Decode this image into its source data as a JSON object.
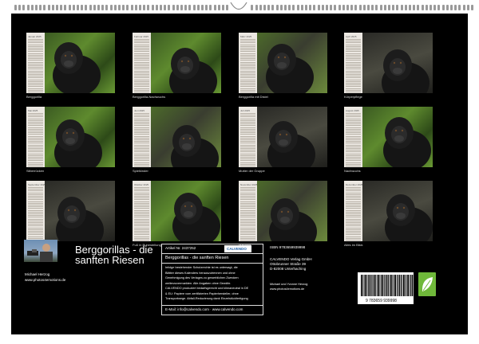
{
  "months": [
    {
      "name": "Januar 2025",
      "caption": "Berggorilla",
      "bg": "bg-green"
    },
    {
      "name": "Februar 2025",
      "caption": "Berggorilla-Nachwuchs",
      "bg": "bg-green"
    },
    {
      "name": "März 2025",
      "caption": "Berggorilla mit Distel",
      "bg": "bg-mid"
    },
    {
      "name": "April 2025",
      "caption": "Körperpflege",
      "bg": "bg-dark"
    },
    {
      "name": "Mai 2025",
      "caption": "Silberrücken",
      "bg": "bg-green"
    },
    {
      "name": "Juni 2025",
      "caption": "Spielkinder",
      "bg": "bg-mid"
    },
    {
      "name": "Juli 2025",
      "caption": "Mutter der Gruppe",
      "bg": "bg-dark"
    },
    {
      "name": "August 2025",
      "caption": "Nachwuchs",
      "bg": "bg-green"
    },
    {
      "name": "September 2025",
      "caption": "Nickerchen",
      "bg": "bg-dark"
    },
    {
      "name": "Oktober 2025",
      "caption": "Fuß in Ruhestellung",
      "bg": "bg-green"
    },
    {
      "name": "November 2025",
      "caption": "Mahlzeit",
      "bg": "bg-mid"
    },
    {
      "name": "Dezember 2025",
      "caption": "Alles im Blick",
      "bg": "bg-dark"
    }
  ],
  "cover": {
    "title": "Berggorillas - die sanften Riesen",
    "author": "Michael Herzog",
    "website": "www.photos4emotions.de"
  },
  "info": {
    "article": "Artikel Nr. 2437252",
    "logo": "CALVENDO",
    "product_title": "Berggorillas - die sanften Riesen",
    "description": [
      "Infolge bestehender Schutzrechte ist es untersagt, die",
      "Blätter dieses Kalenders herauszutrennen und ohne",
      "Genehmigung des Verlages zu gewerblichen Zwecken",
      "weiterzuvermarkten. Alle Angaben ohne Gewähr.",
      "CALVENDO produziert bedarfsgerecht und klimaneutral in DE",
      "& EU: Papiere vom zertifizierten Papierhersteller, ohne",
      "Transportwege. Abfall-Reduzierung dank Einzelstückfertigung"
    ],
    "contact": "E-Mail: info@calvendo.com · www.calvendo.com"
  },
  "publisher": {
    "isbn": "ISBN 9783659939998",
    "lines": [
      "CALVENDO Verlag GmbH",
      "Ottobrunner Straße 39",
      "D-82008 Unterhaching"
    ],
    "credit": [
      "Michael und Yvonne Herzog",
      "www.photos4emotions.de"
    ]
  },
  "barcode_number": "9 783659 939998"
}
